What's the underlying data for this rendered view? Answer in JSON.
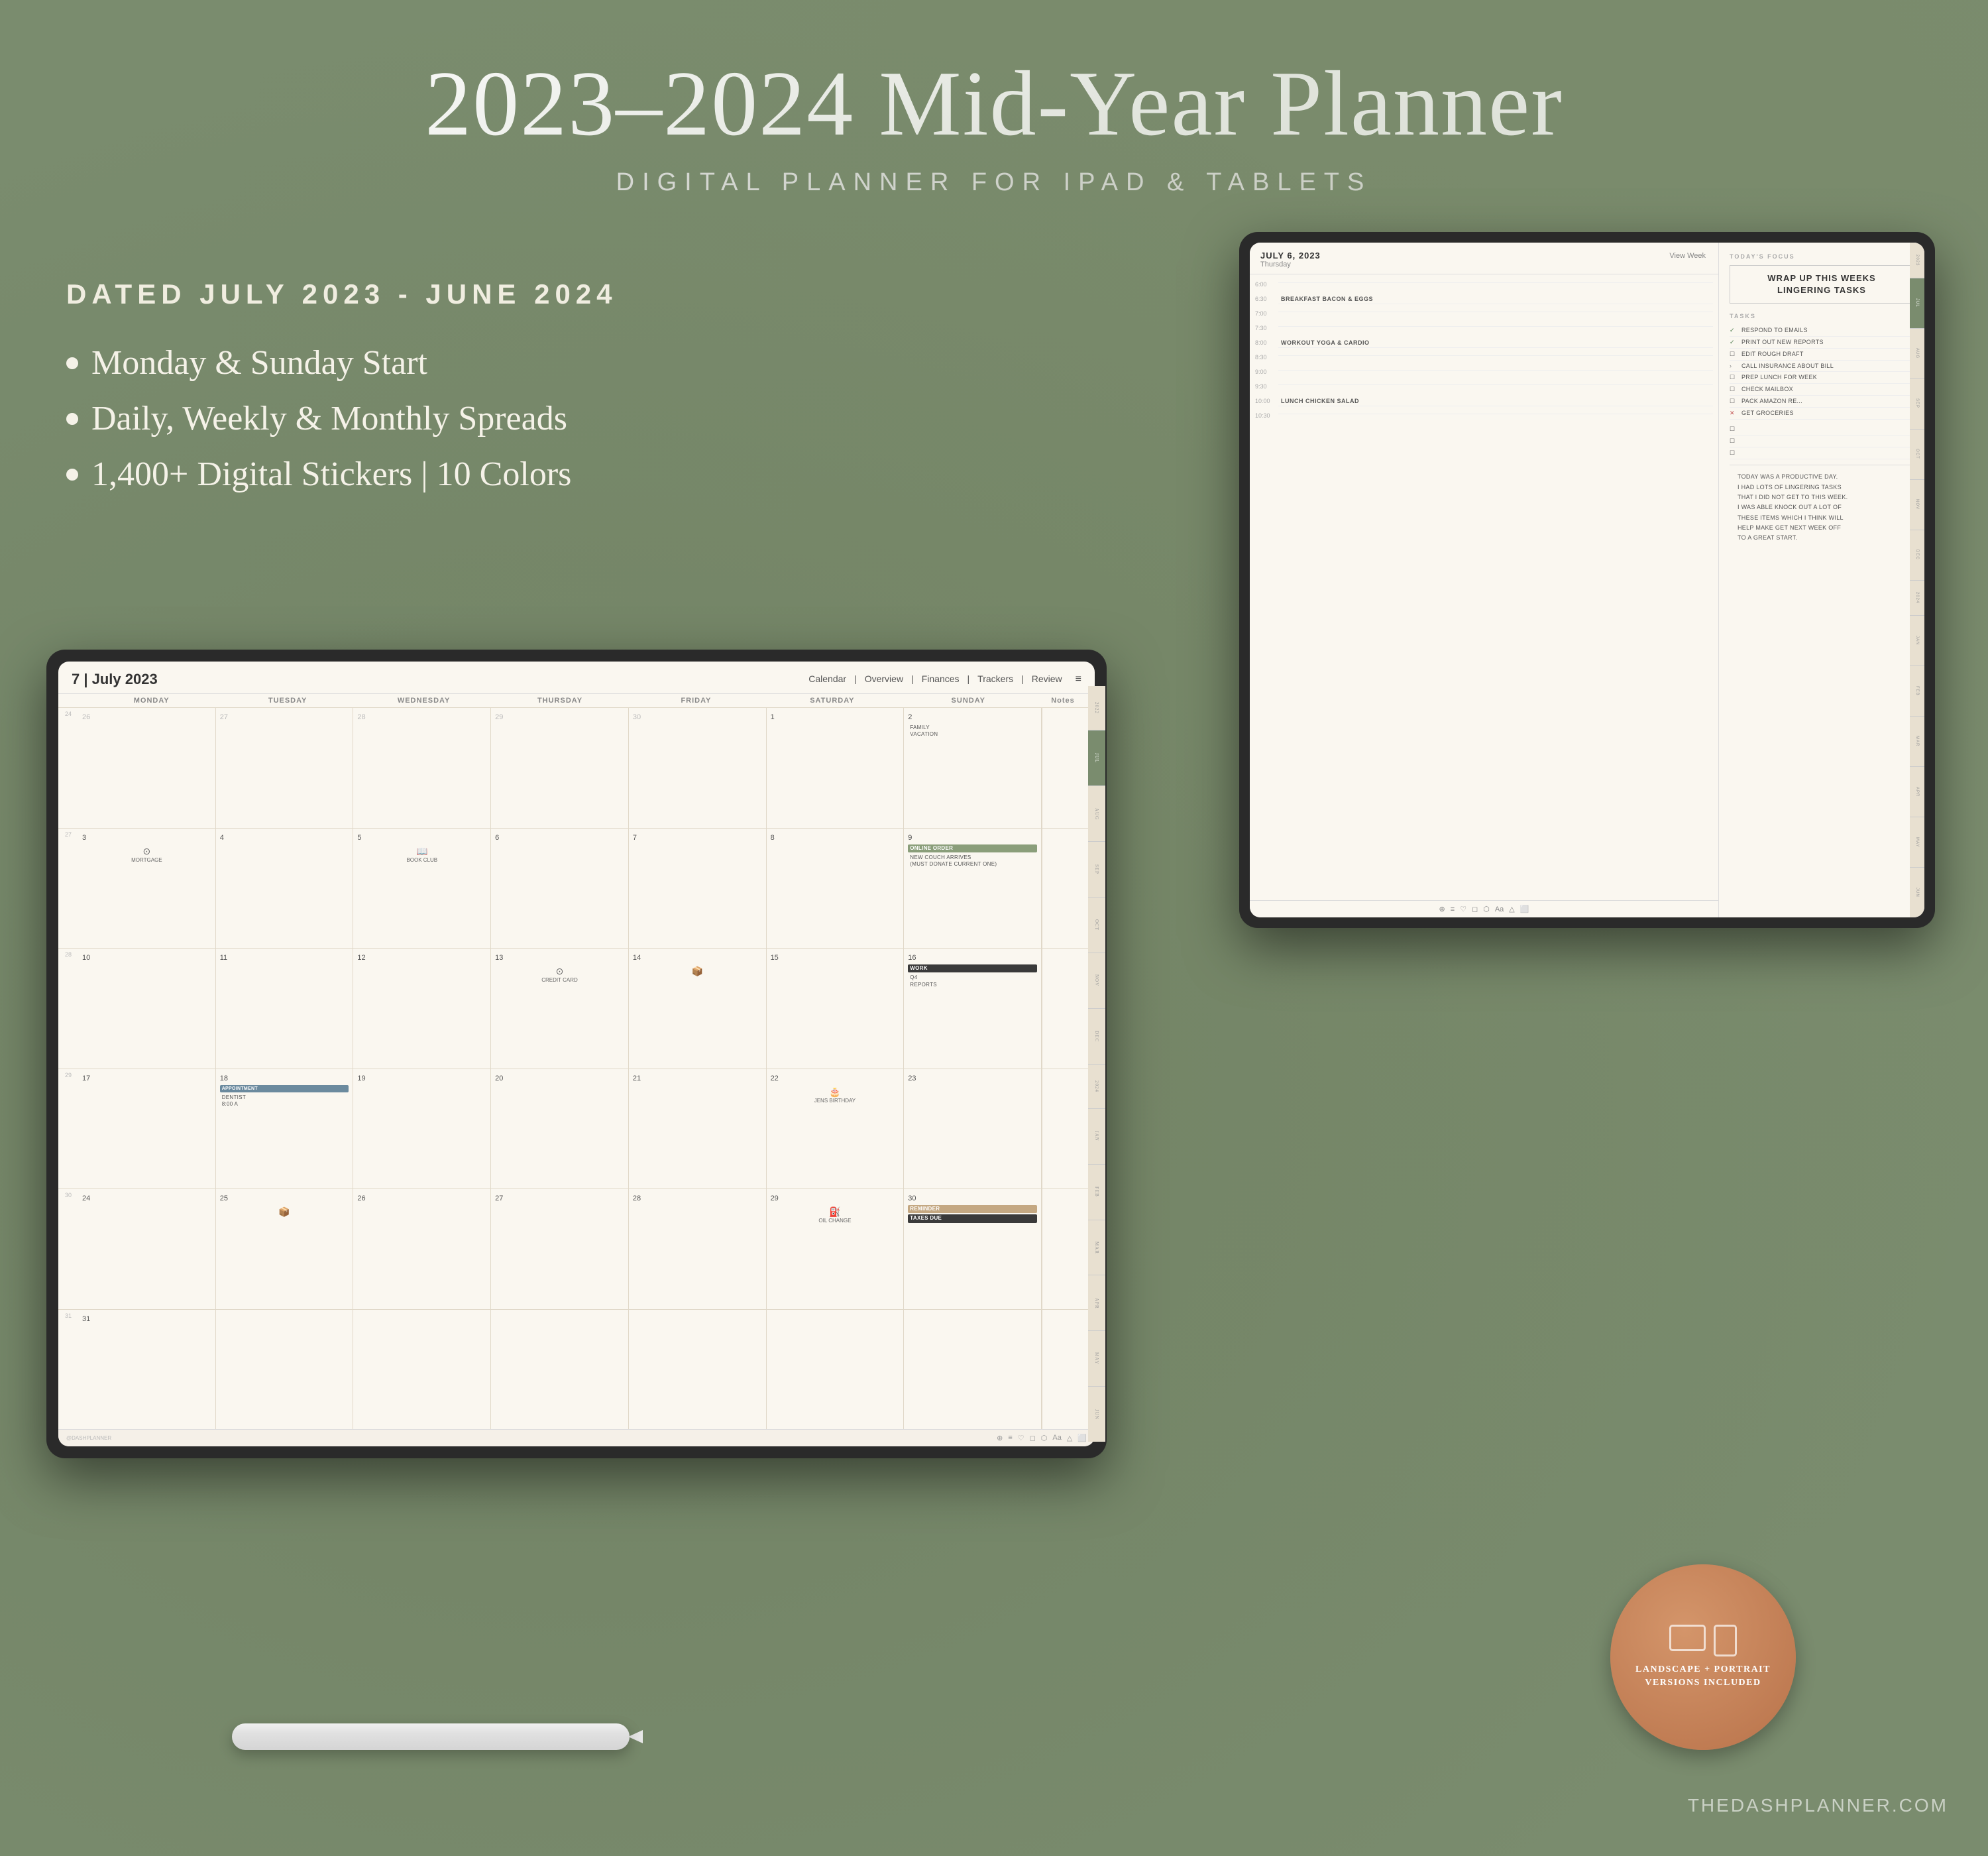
{
  "header": {
    "main_title": "2023–2024 Mid-Year Planner",
    "sub_title": "DIGITAL PLANNER FOR IPAD & TABLETS"
  },
  "left_panel": {
    "dated_label": "DATED JULY 2023 - JUNE 2024",
    "bullets": [
      "Monday & Sunday Start",
      "Daily, Weekly & Monthly Spreads",
      "1,400+ Digital Stickers | 10 Colors"
    ]
  },
  "calendar": {
    "month_title": "7  |  July 2023",
    "nav_items": [
      "Calendar",
      "Overview",
      "Finances",
      "Trackers",
      "Review"
    ],
    "day_names": [
      "MONDAY",
      "TUESDAY",
      "WEDNESDAY",
      "THURSDAY",
      "FRIDAY",
      "SATURDAY",
      "SUNDAY"
    ],
    "notes_header": "Notes",
    "weeks": [
      {
        "week_num": "24",
        "days": [
          {
            "num": "26",
            "other": true,
            "events": []
          },
          {
            "num": "27",
            "other": true,
            "events": []
          },
          {
            "num": "28",
            "other": true,
            "events": []
          },
          {
            "num": "29",
            "other": true,
            "events": []
          },
          {
            "num": "30",
            "other": true,
            "events": []
          },
          {
            "num": "1",
            "other": false,
            "events": []
          },
          {
            "num": "2",
            "other": false,
            "events": [
              {
                "text": "FAMILY VACATION",
                "type": "text-only"
              }
            ]
          }
        ],
        "notes": ""
      },
      {
        "week_num": "27",
        "days": [
          {
            "num": "3",
            "other": false,
            "events": [
              {
                "text": "⊙ MORTGAGE",
                "type": "icon-text"
              }
            ]
          },
          {
            "num": "4",
            "other": false,
            "events": []
          },
          {
            "num": "5",
            "other": false,
            "events": [
              {
                "text": "📖 BOOK CLUB",
                "type": "icon-text"
              }
            ]
          },
          {
            "num": "6",
            "other": false,
            "events": []
          },
          {
            "num": "7",
            "other": false,
            "events": []
          },
          {
            "num": "8",
            "other": false,
            "events": []
          },
          {
            "num": "9",
            "other": false,
            "events": [
              {
                "text": "ONLINE ORDER",
                "type": "green-bg"
              },
              {
                "text": "NEW COUCH ARRIVES (MUST DONATE CURRENT ONE)",
                "type": "text-only"
              }
            ]
          }
        ],
        "notes": ""
      },
      {
        "week_num": "28",
        "days": [
          {
            "num": "10",
            "other": false,
            "events": []
          },
          {
            "num": "11",
            "other": false,
            "events": []
          },
          {
            "num": "12",
            "other": false,
            "events": []
          },
          {
            "num": "13",
            "other": false,
            "events": [
              {
                "text": "⊙ CREDIT CARD",
                "type": "icon-text"
              }
            ]
          },
          {
            "num": "14",
            "other": false,
            "events": [
              {
                "text": "📦",
                "type": "icon-only"
              }
            ]
          },
          {
            "num": "15",
            "other": false,
            "events": []
          },
          {
            "num": "16",
            "other": false,
            "events": [
              {
                "text": "WORK",
                "type": "dark-bg"
              },
              {
                "text": "Q4 REPORTS",
                "type": "text-only"
              }
            ]
          }
        ],
        "notes": ""
      },
      {
        "week_num": "29",
        "days": [
          {
            "num": "17",
            "other": false,
            "events": []
          },
          {
            "num": "18",
            "other": false,
            "events": [
              {
                "text": "APPOINTMENT",
                "type": "appointment-bg"
              },
              {
                "text": "DENTIST 8:00 A",
                "type": "text-only"
              }
            ]
          },
          {
            "num": "19",
            "other": false,
            "events": []
          },
          {
            "num": "20",
            "other": false,
            "events": []
          },
          {
            "num": "21",
            "other": false,
            "events": []
          },
          {
            "num": "22",
            "other": false,
            "events": [
              {
                "text": "🎂 JENS BIRTHDAY",
                "type": "icon-text"
              }
            ]
          },
          {
            "num": "23",
            "other": false,
            "events": []
          }
        ],
        "notes": ""
      },
      {
        "week_num": "30",
        "days": [
          {
            "num": "24",
            "other": false,
            "events": []
          },
          {
            "num": "25",
            "other": false,
            "events": [
              {
                "text": "📦",
                "type": "icon-only"
              }
            ]
          },
          {
            "num": "26",
            "other": false,
            "events": []
          },
          {
            "num": "27",
            "other": false,
            "events": []
          },
          {
            "num": "28",
            "other": false,
            "events": []
          },
          {
            "num": "29",
            "other": false,
            "events": [
              {
                "text": "⛽ OIL CHANGE",
                "type": "icon-text"
              }
            ]
          },
          {
            "num": "30",
            "other": false,
            "events": [
              {
                "text": "REMINDER",
                "type": "reminder-bg"
              },
              {
                "text": "TAXES DUE",
                "type": "dark-bg"
              }
            ]
          }
        ],
        "notes": ""
      },
      {
        "week_num": "31",
        "days": [
          {
            "num": "31",
            "other": false,
            "events": []
          },
          {
            "num": "",
            "other": true,
            "events": []
          },
          {
            "num": "",
            "other": true,
            "events": []
          },
          {
            "num": "",
            "other": true,
            "events": []
          },
          {
            "num": "",
            "other": true,
            "events": []
          },
          {
            "num": "",
            "other": true,
            "events": []
          },
          {
            "num": "",
            "other": true,
            "events": []
          }
        ],
        "notes": ""
      }
    ],
    "side_months": [
      "2022",
      "JUL",
      "AUG",
      "SEP",
      "OCT",
      "NOV",
      "DEC",
      "2024",
      "JAN",
      "FEB",
      "MAR",
      "APR",
      "MAY",
      "JUN"
    ],
    "copyright": "@DASHPLANNER"
  },
  "daily": {
    "date": "JULY 6, 2023",
    "weekday": "Thursday",
    "view_week": "View Week",
    "focus_label": "TODAY'S FOCUS",
    "focus_text": "WRAP UP THIS WEEKS\nLINGERING TASKS",
    "tasks_label": "TASKS",
    "tasks": [
      {
        "check": "✓",
        "text": "RESPOND TO EMAILS",
        "type": "checked"
      },
      {
        "check": "✓",
        "text": "PRINT OUT NEW REPORTS",
        "type": "checked"
      },
      {
        "check": "☐",
        "text": "EDIT ROUGH DRAFT",
        "type": "unchecked"
      },
      {
        "check": ">",
        "text": "CALL INSURANCE ABOUT BILL",
        "type": "arrow"
      },
      {
        "check": "☐",
        "text": "PREP LUNCH FOR WEEK",
        "type": "unchecked"
      },
      {
        "check": "☐",
        "text": "CHECK MAILBOX",
        "type": "unchecked"
      },
      {
        "check": "☐",
        "text": "PACK AMAZON RE...",
        "type": "unchecked"
      },
      {
        "check": "✕",
        "text": "GET GROCERIES",
        "type": "cross"
      }
    ],
    "schedule": [
      {
        "time": "6:00",
        "event": ""
      },
      {
        "time": "6:30",
        "event": "BREAKFAST  BACON & EGGS"
      },
      {
        "time": "7:00",
        "event": ""
      },
      {
        "time": "7:30",
        "event": ""
      },
      {
        "time": "8:00",
        "event": "WORKOUT  YOGA & CARDIO"
      },
      {
        "time": "8:30",
        "event": ""
      },
      {
        "time": "9:00",
        "event": ""
      },
      {
        "time": "9:30",
        "event": ""
      },
      {
        "time": "10:00",
        "event": "LUNCH  CHICKEN SALAD"
      },
      {
        "time": "10:30",
        "event": ""
      }
    ],
    "notes_text": "TODAY WAS A PRODUCTIVE DAY.\nI HAD LOTS OF LINGERING TASKS\nTHAT I DID NOT GET TO THIS WEEK.\nI WAS ABLE KNOCK OUT A LOT OF\nTHESE ITEMS WHICH I THINK WILL\nHELP MAKE GET NEXT WEEK OFF\nTO A GREAT START.",
    "side_tabs": [
      "2023",
      "JUL",
      "AUG",
      "SEP",
      "OCT",
      "NOV",
      "DEC",
      "2024",
      "JAN",
      "FEB",
      "MAR",
      "APR",
      "MAY",
      "JUN"
    ]
  },
  "badge": {
    "text": "LANDSCAPE + PORTRAIT\nVERSIONS INCLUDED"
  },
  "watermark": {
    "text": "THEDASHPLANNER.COM"
  }
}
